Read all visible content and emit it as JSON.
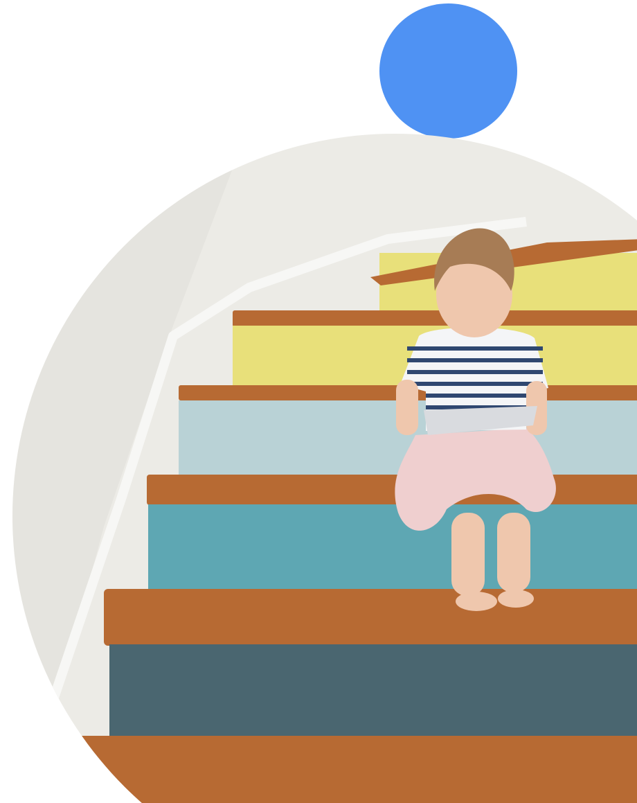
{
  "colors": {
    "accent_dot": "#4f92f3",
    "background": "#ffffff",
    "wall": "#ecebe6",
    "wall_shadow": "#d9d8d2",
    "handrail": "#f7f7f5",
    "tread_wood": "#b76a33",
    "tread_wood_dark": "#8f4e22",
    "riser_yellow": "#e8e07a",
    "riser_pale_blue": "#b9d2d6",
    "riser_teal": "#5ea7b3",
    "riser_slate": "#4a6670",
    "shirt_stripe": "#2f4770",
    "skirt_pink": "#efcfcf",
    "skin": "#efc7ad",
    "hair": "#a77c55",
    "tablet": "#d9dbdf"
  },
  "icons": {
    "accent_shape": "blue-circle"
  }
}
